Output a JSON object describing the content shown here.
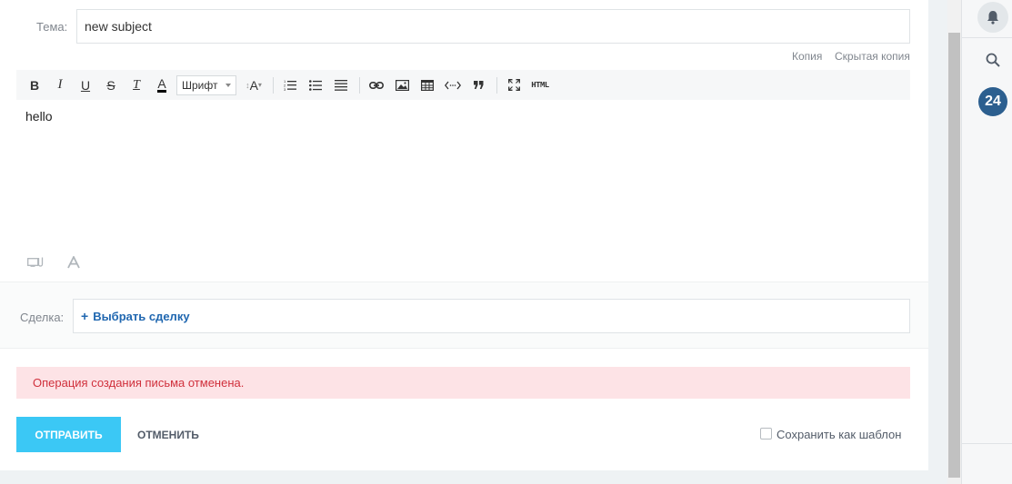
{
  "subject": {
    "label": "Тема:",
    "value": "new subject"
  },
  "copy_links": {
    "cc": "Копия",
    "bcc": "Скрытая копия"
  },
  "toolbar": {
    "bold": "B",
    "italic": "I",
    "underline": "U",
    "strike": "S",
    "clear_format": "T",
    "font_color": "A",
    "font_select": "Шрифт",
    "font_size": "A",
    "html": "HTML"
  },
  "editor": {
    "body": "hello"
  },
  "deal": {
    "label": "Сделка:",
    "plus": "+",
    "link": "Выбрать сделку"
  },
  "alert": {
    "text": "Операция создания письма отменена."
  },
  "actions": {
    "send": "ОТПРАВИТЬ",
    "cancel": "ОТМЕНИТЬ",
    "save_template": "Сохранить как шаблон"
  },
  "right_rail": {
    "counter": "24"
  },
  "colors": {
    "send": "#3bc8f5",
    "link": "#2067b0",
    "alert_bg": "#fde3e6",
    "alert_text": "#d0303c",
    "counter_bg": "#2c5f8f"
  },
  "icons": [
    "bold-icon",
    "italic-icon",
    "underline-icon",
    "strike-icon",
    "clear-format-icon",
    "font-color-icon",
    "font-size-icon",
    "ordered-list-icon",
    "bullet-list-icon",
    "align-icon",
    "link-icon",
    "image-icon",
    "table-icon",
    "code-icon",
    "quote-icon",
    "fullscreen-icon",
    "html-icon",
    "attach-icon",
    "text-format-icon",
    "bell-icon",
    "search-icon"
  ]
}
